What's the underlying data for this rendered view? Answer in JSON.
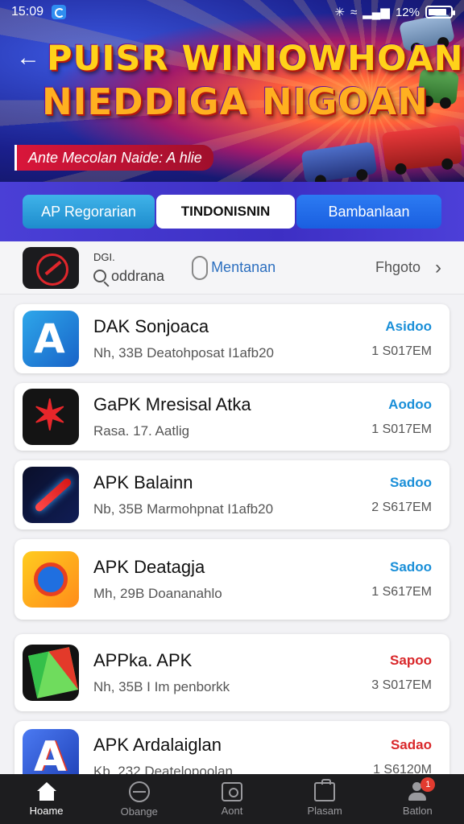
{
  "status": {
    "time": "15:09",
    "battery_text": "12%",
    "battery_level": 0.85
  },
  "banner": {
    "title_line1": "PUISR WINIOWHOAN",
    "title_line2": "NIEDDIGA NIGOAN",
    "subtitle": "Ante Mecolan Naide: A hlie"
  },
  "tabs": [
    {
      "label": "AP Regorarian"
    },
    {
      "label": "TINDONISNIN"
    },
    {
      "label": "Bambanlaan"
    }
  ],
  "filter": {
    "label": "DGI.",
    "search_text": "oddrana",
    "toggle_label": "Mentanan",
    "right_label": "Fhgoto"
  },
  "apps": [
    {
      "name": "DAK Sonjoaca",
      "sub": "Nh, 33B Deatohposat I1afb20",
      "action": "Asidoo",
      "action_color": "#1a8fd8",
      "size": "1 S017EM",
      "icon": "a-letter-icon"
    },
    {
      "name": "GaPK Mresisal Atka",
      "sub": "Rasa. 17. Aatlig",
      "action": "Aodoo",
      "action_color": "#1a8fd8",
      "size": "1 S017EM",
      "icon": "star-burst-icon"
    },
    {
      "name": "APK Balainn",
      "sub": "Nb, 35B Marmohpnat I1afb20",
      "action": "Sadoo",
      "action_color": "#1a8fd8",
      "size": "2 S617EM",
      "icon": "pen-icon"
    },
    {
      "name": "APK Deatagja",
      "sub": "Mh, 29B Doananahlo",
      "action": "Sadoo",
      "action_color": "#1a8fd8",
      "size": "1 S617EM",
      "icon": "orange-ring-icon"
    },
    {
      "name": "APPka. APK",
      "sub": "Nh, 35B I Im penborkk",
      "action": "Sapoo",
      "action_color": "#d9272a",
      "size": "3 S017EM",
      "icon": "kite-icon"
    },
    {
      "name": "APK Ardalaiglan",
      "sub": "Kb, 232 Deatelopoolan",
      "action": "Sadao",
      "action_color": "#d9272a",
      "size": "1 S6120M",
      "icon": "a-letter-icon"
    }
  ],
  "nav": [
    {
      "label": "Hoame",
      "icon": "home-icon"
    },
    {
      "label": "Obange",
      "icon": "globe-icon"
    },
    {
      "label": "Aont",
      "icon": "box-icon"
    },
    {
      "label": "Plasam",
      "icon": "bag-icon"
    },
    {
      "label": "Batlon",
      "icon": "person-icon",
      "badge": "1"
    }
  ]
}
